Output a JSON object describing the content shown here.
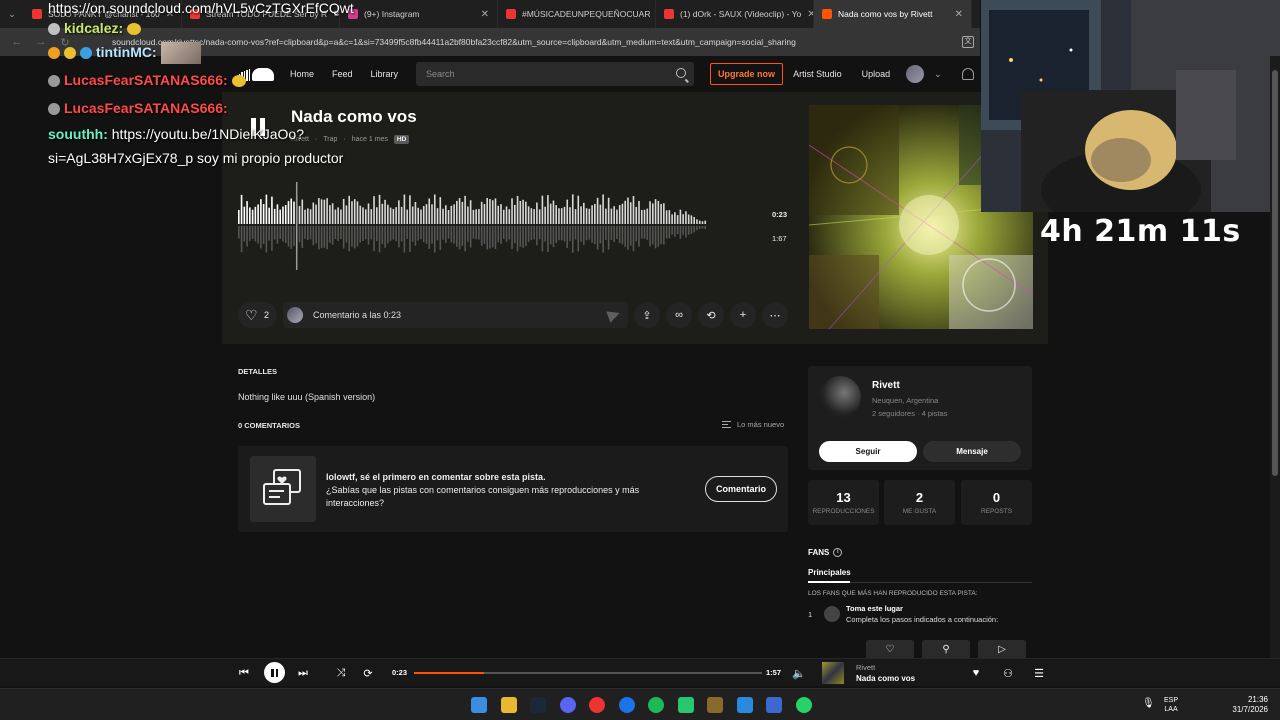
{
  "browser": {
    "tabs": [
      {
        "title": "SOLO PANKY @charlst - 160",
        "color": "#e33"
      },
      {
        "title": "Stream TODO PUEDE Ser by R",
        "color": "#e33"
      },
      {
        "title": "(9+) Instagram",
        "color": "#d63c8a"
      },
      {
        "title": "#MÚSICADEUNPEQUEÑOCUAR",
        "color": "#e33"
      },
      {
        "title": "(1) dOrk - SAUX (Videoclip) - Yo",
        "color": "#e33"
      },
      {
        "title": "Nada como vos by Rivett",
        "color": "#ff5500"
      }
    ],
    "url": "soundcloud.com/rivettsc/nada-como-vos?ref=clipboard&p=a&c=1&si=73499f5c8fb44411a2bf80bfa23ccf82&utm_source=clipboard&utm_medium=text&utm_campaign=social_sharing",
    "close_glyph": "✕",
    "menu_glyph": "⌄",
    "back_glyph": "←",
    "forward_glyph": "→",
    "reload_glyph": "↻",
    "translate_glyph": "文"
  },
  "header": {
    "nav": [
      "Home",
      "Feed",
      "Library"
    ],
    "search_placeholder": "Search",
    "upgrade": "Upgrade now",
    "artist_studio": "Artist Studio",
    "upload": "Upload",
    "chevron": "⌄"
  },
  "track": {
    "title": "Nada como vos",
    "artist": "Rivett",
    "genre": "Trap",
    "age": "hace 1 mes",
    "hd": "HD",
    "current_time": "0:23",
    "duration": "1:57",
    "wave_total_time": "1:67",
    "progress": 0.2,
    "likes": "2",
    "comment_placeholder": "Comentario a las 0:23"
  },
  "actions": {
    "icons": [
      "share-icon",
      "link-icon",
      "repost-icon",
      "add-to-playlist-icon",
      "more-icon"
    ],
    "glyphs": [
      "⇪",
      "∞",
      "⟲",
      "+",
      "⋯"
    ]
  },
  "chat": {
    "link_top": "https://on.soundcloud.com/hVL5vCzTGXrEfCQwt",
    "messages": [
      {
        "user": "kidcalez:",
        "text": ""
      },
      {
        "user": "tintinMC:",
        "text": ""
      },
      {
        "user": "LucasFearSATANAS666:",
        "text": ""
      },
      {
        "user": "LucasFearSATANAS666:",
        "text": ""
      },
      {
        "user": "souuthh:",
        "text": "https://youtu.be/1NDielKJaOo?"
      }
    ],
    "continuation": "si=AgL38H7xGjEx78_p soy mi propio productor"
  },
  "stream": {
    "timer": "4h 21m 11s"
  },
  "details": {
    "label": "DETALLES",
    "description": "Nothing like uuu (Spanish version)",
    "comments_label": "0 COMENTARIOS",
    "sort_label": "Lo más nuevo",
    "cta_title": "lolowtf, sé el primero en comentar sobre esta pista.",
    "cta_body": "¿Sabías que las pistas con comentarios consiguen más reproducciones y más interacciones?",
    "cta_button": "Comentario"
  },
  "artist": {
    "name": "Rivett",
    "location": "Neuquen, Argentina",
    "stats": "2 seguidores · 4 pistas",
    "follow": "Seguir",
    "message": "Mensaje"
  },
  "stats": [
    {
      "value": "13",
      "label": "REPRODUCCIONES"
    },
    {
      "value": "2",
      "label": "ME GUSTA"
    },
    {
      "value": "0",
      "label": "REPOSTS"
    }
  ],
  "fans": {
    "title": "FANS",
    "info_glyph": "i",
    "tab": "Principales",
    "subtitle": "LOS FANS QUE MÁS HAN REPRODUCIDO ESTA PISTA:",
    "rank": "1",
    "top_name": "Toma este lugar",
    "top_desc": "Completa los pasos indicados a continuación:",
    "peek_glyphs": [
      "♡",
      "⚲",
      "▷"
    ]
  },
  "player": {
    "current_time": "0:23",
    "duration": "1:57",
    "progress": 0.2,
    "artist": "Rivett",
    "title": "Nada como vos",
    "glyphs": {
      "prev": "⏮",
      "next": "⏭",
      "shuffle": "⤨",
      "repeat": "⟳",
      "volume": "🔈",
      "like": "♥",
      "follow": "⚇",
      "queue": "☰"
    }
  },
  "taskbar": {
    "lang_top": "ESP",
    "lang_bottom": "LAA",
    "time": "21:36",
    "date": "31/7/2026",
    "mic_glyph": "🎙",
    "app_colors": [
      "#3b8de0",
      "#e8b830",
      "#1b2838",
      "#5865f2",
      "#e33",
      "#1a73e8",
      "#1db954",
      "#28c76f",
      "#8a6a2a",
      "#2a8ae0",
      "#3a6ad0",
      "#25d366"
    ]
  }
}
